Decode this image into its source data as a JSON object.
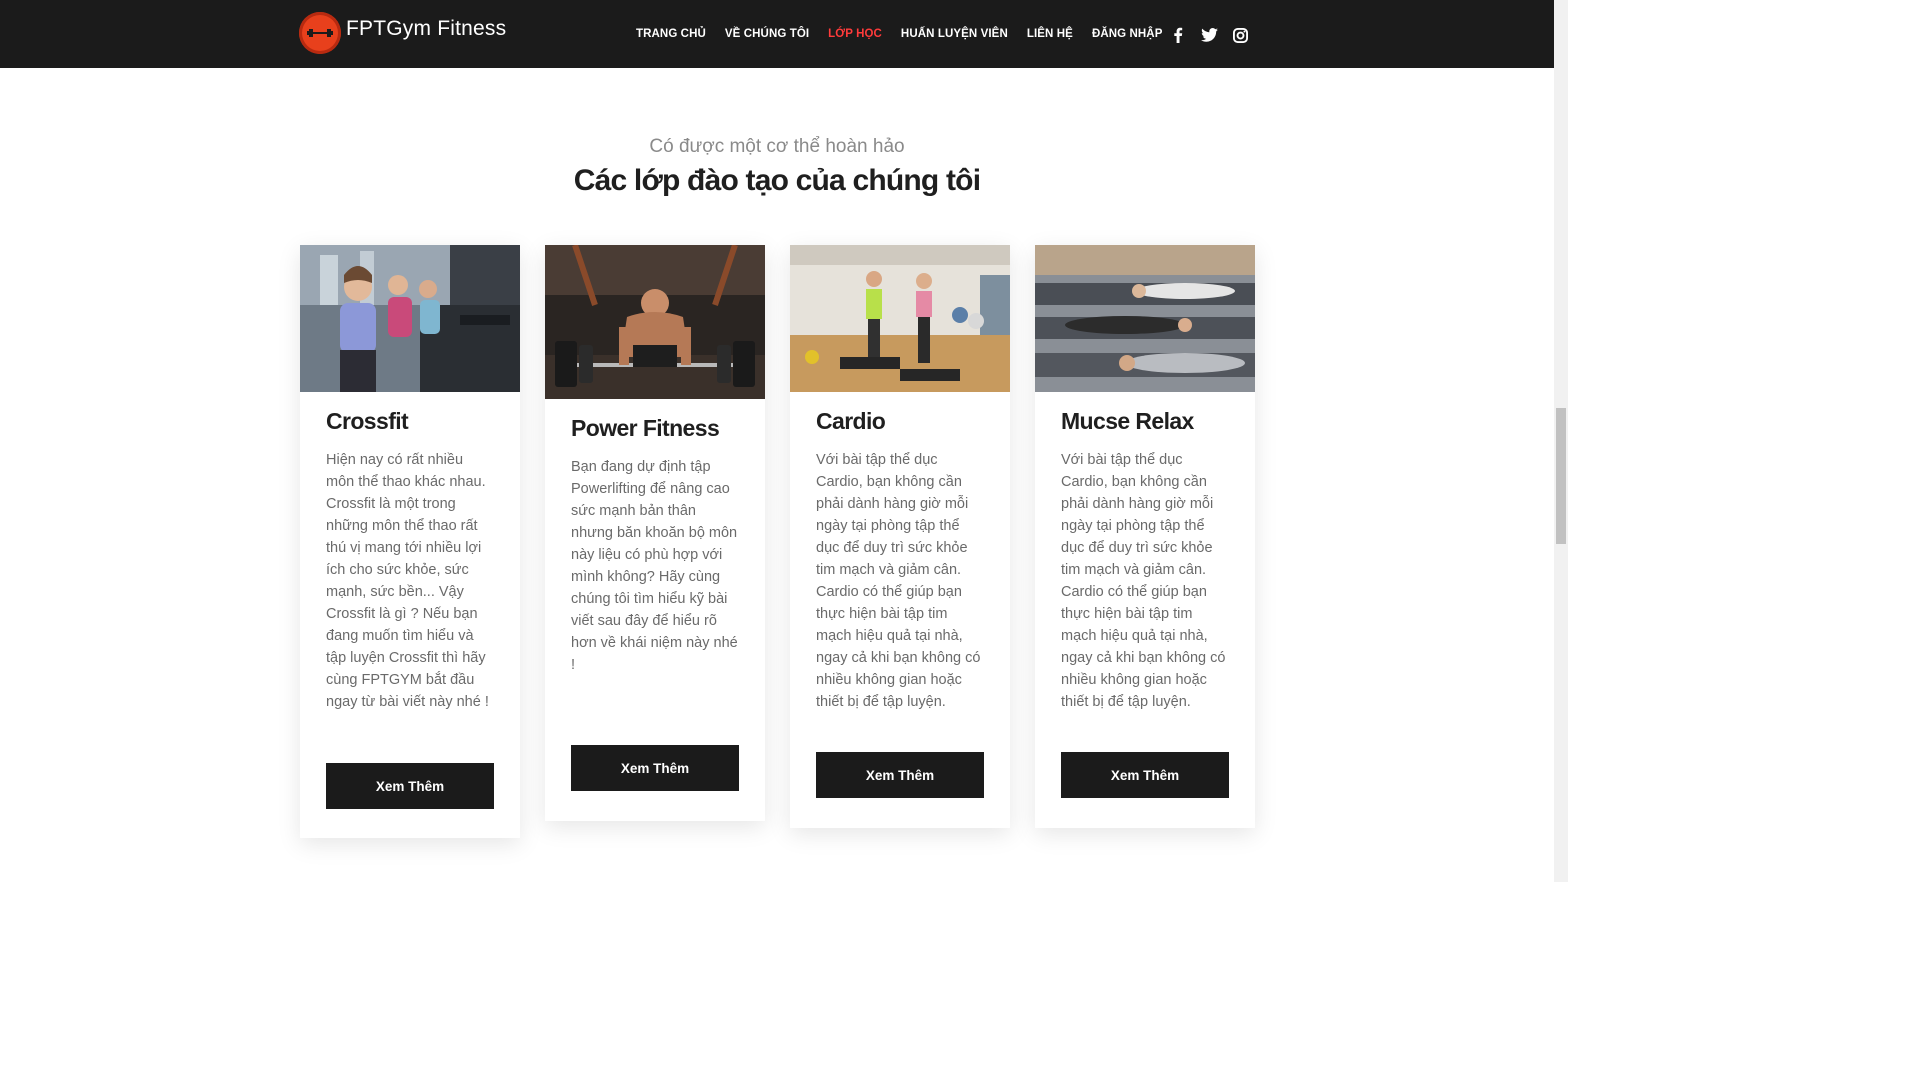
{
  "header": {
    "brand": "FPTGym Fitness",
    "logo_text": "FPT GYM",
    "nav": [
      {
        "label": "TRANG CHỦ",
        "active": false
      },
      {
        "label": "VỀ CHÚNG TÔI",
        "active": false
      },
      {
        "label": "LỚP HỌC",
        "active": true
      },
      {
        "label": "HUẤN LUYỆN VIÊN",
        "active": false
      },
      {
        "label": "LIÊN HỆ",
        "active": false
      },
      {
        "label": "ĐĂNG NHẬP",
        "active": false
      }
    ],
    "social_icons": [
      "facebook-icon",
      "twitter-icon",
      "instagram-icon"
    ]
  },
  "section": {
    "subtitle": "Có được một cơ thể hoàn hảo",
    "title": "Các lớp đào tạo của chúng tôi"
  },
  "classes": [
    {
      "title": "Crossfit",
      "description": "Hiện nay có rất nhiều môn thể thao khác nhau. Crossfit là một trong những môn thể thao rất thú vị mang tới nhiều lợi ích cho sức khỏe, sức mạnh, sức bền... Vậy Crossfit là gì ? Nếu bạn đang muốn tìm hiểu và tập luyện Crossfit thì hãy cùng FPTGYM bắt đầu ngay từ bài viết này nhé !",
      "button": "Xem Thêm"
    },
    {
      "title": "Power Fitness",
      "description": "Bạn đang dự định tập Powerlifting để nâng cao sức mạnh bản thân nhưng băn khoăn bộ môn này liệu có phù hợp với mình không? Hãy cùng chúng tôi tìm hiểu kỹ bài viết sau đây để hiểu rõ hơn về khái niệm này nhé !",
      "button": "Xem Thêm"
    },
    {
      "title": "Cardio",
      "description": "Với bài tập thể dục Cardio, bạn không cần phải dành hàng giờ mỗi ngày tại phòng tập thể dục để duy trì sức khỏe tim mạch và giảm cân. Cardio có thể giúp bạn thực hiện bài tập tim mạch hiệu quả tại nhà, ngay cả khi bạn không có nhiều không gian hoặc thiết bị để tập luyện.",
      "button": "Xem Thêm"
    },
    {
      "title": "Mucse Relax",
      "description": "Với bài tập thể dục Cardio, bạn không cần phải dành hàng giờ mỗi ngày tại phòng tập thể dục để duy trì sức khỏe tim mạch và giảm cân. Cardio có thể giúp bạn thực hiện bài tập tim mạch hiệu quả tại nhà, ngay cả khi bạn không có nhiều không gian hoặc thiết bị để tập luyện.",
      "button": "Xem Thêm"
    }
  ],
  "colors": {
    "header_bg": "#1b1b1b",
    "active_nav": "#ff3b3b",
    "logo": "#e8401c",
    "button_bg": "#1b1b1b"
  }
}
